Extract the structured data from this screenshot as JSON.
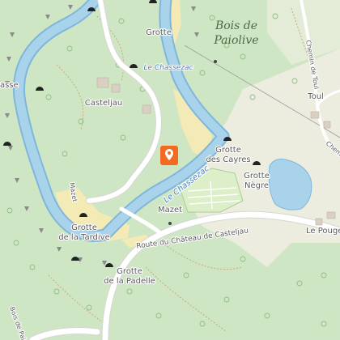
{
  "map": {
    "forest_name_line1": "Bois de",
    "forest_name_line2": "Paiolive",
    "river_name": "Le Chassezac",
    "river_name_2": "Le Chassezac",
    "road_name": "Route du Château de Casteljau",
    "road_left_name": "Bois de Paiolive",
    "road_right_top": "Chemin de Toul",
    "road_right_mid": "Chem",
    "place_casteljau": "Casteljau",
    "place_mazet": "Mazet",
    "place_mazet_vertical": "Mazet",
    "place_toul": "Toul",
    "place_pouget": "Le Pouge",
    "place_left_edge": "asse",
    "cave_grotte_top": "Grotte",
    "cave_cayres_1": "Grotte",
    "cave_cayres_2": "des Cayres",
    "cave_negre_1": "Grotte",
    "cave_negre_2": "Nègre",
    "cave_tardive_1": "Grotte",
    "cave_tardive_2": "de la Tardive",
    "cave_padelle": "Grotte",
    "cave_padelle_2": "de la Padelle",
    "marker_icon": "location-pin-icon",
    "colors": {
      "forest": "#cfe6c4",
      "meadow": "#e9eadf",
      "water": "#a9d3ea",
      "river_outline": "#7fb6dc",
      "sand": "#f4eab6",
      "road": "#ffffff",
      "marker": "#f26b21"
    }
  }
}
